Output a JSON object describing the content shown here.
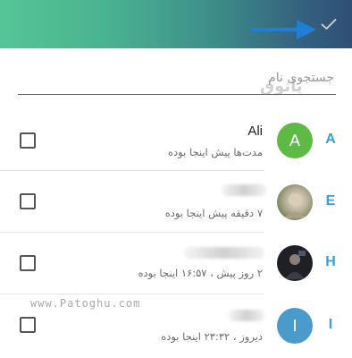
{
  "header": {
    "confirm_icon": "checkmark-icon",
    "gradient_start": "#56c594",
    "gradient_end": "#2f4f74"
  },
  "search": {
    "placeholder": "جستجوی نام",
    "value": ""
  },
  "watermark": {
    "logo_text": "پاتوق",
    "site_text": "www.Patoghu.com"
  },
  "contacts": [
    {
      "letter": "A",
      "name": "Ali",
      "status": "مدت‌ها پیش اینجا بوده",
      "avatar_type": "initial",
      "avatar_initial": "A",
      "avatar_color": "#5dbb45",
      "checked": false
    },
    {
      "letter": "E",
      "name": "",
      "status": "۷ دقیقه پیش اینجا بوده",
      "avatar_type": "photo",
      "avatar_initial": "",
      "avatar_color": "#c8c0ae",
      "checked": false
    },
    {
      "letter": "H",
      "name": "",
      "status": "۲ روز پیش ، ۱۶:۵۷ اینجا بوده",
      "avatar_type": "photo",
      "avatar_initial": "",
      "avatar_color": "#1f2026",
      "checked": false
    },
    {
      "letter": "I",
      "name": "",
      "status": "دیروز ، ۲۳:۳۲ اینجا بوده",
      "avatar_type": "initial",
      "avatar_initial": "I",
      "avatar_color": "#4a9bcc",
      "checked": false
    }
  ],
  "colors": {
    "index_letter": "#3a9fd6",
    "status_text": "#6b6b6b"
  }
}
